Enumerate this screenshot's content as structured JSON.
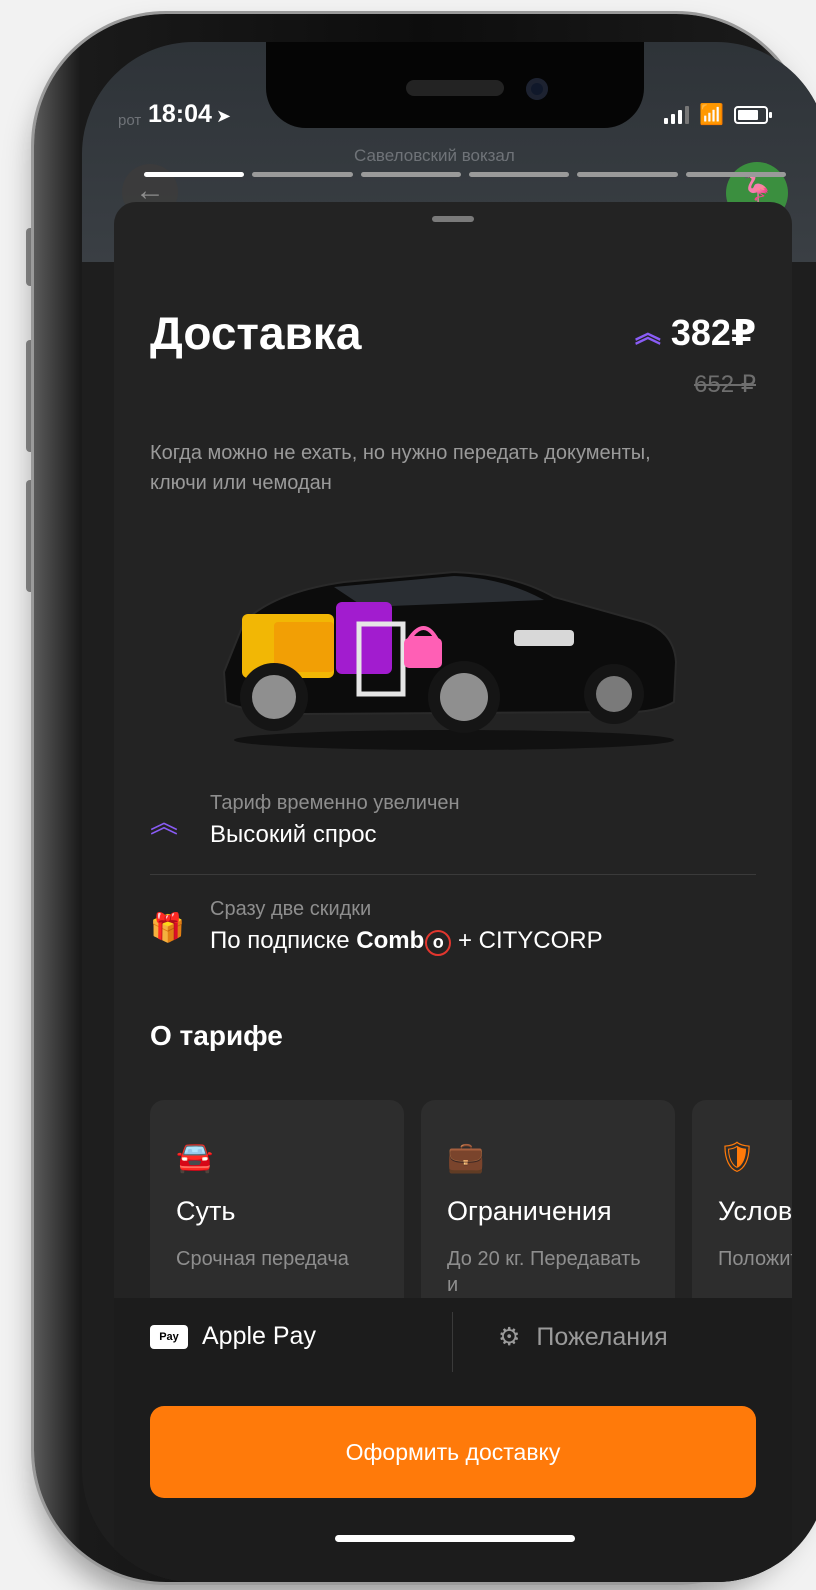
{
  "status_bar": {
    "time": "18:04",
    "location_icon": "location-arrow-icon"
  },
  "map": {
    "station_label": "Савеловский вокзал",
    "street_label": "рот",
    "back_icon": "←",
    "ostrich_icon": "🦩"
  },
  "stories_progress": {
    "total": 6,
    "active": 1
  },
  "tariff": {
    "title": "Доставка",
    "price": "382₽",
    "old_price": "652 ₽",
    "description": "Когда можно не ехать, но нужно передать документы, ключи или чемодан"
  },
  "surge": {
    "label": "Тариф временно увеличен",
    "value": "Высокий спрос"
  },
  "discount": {
    "label": "Сразу две скидки",
    "value_prefix": "По подписке",
    "combo_text": "Comb",
    "combo_o": "o",
    "value_suffix": "+ CITYCORP"
  },
  "about": {
    "title": "О тарифе",
    "cards": [
      {
        "icon": "car-icon",
        "title": "Суть",
        "text": "Срочная передача"
      },
      {
        "icon": "suitcase-icon",
        "title": "Ограничения",
        "text": "До 20 кг. Передавать и"
      },
      {
        "icon": "shield-icon",
        "title": "Условия",
        "text": "Положить во что-"
      }
    ]
  },
  "payment": {
    "badge": "Pay",
    "method": "Apple Pay"
  },
  "wishes": {
    "label": "Пожелания"
  },
  "order_button": {
    "label": "Оформить доставку"
  },
  "colors": {
    "accent": "#ff7a0a",
    "surge": "#8a5cf6",
    "gift": "#ff7a0a",
    "combo": "#e2362e"
  }
}
